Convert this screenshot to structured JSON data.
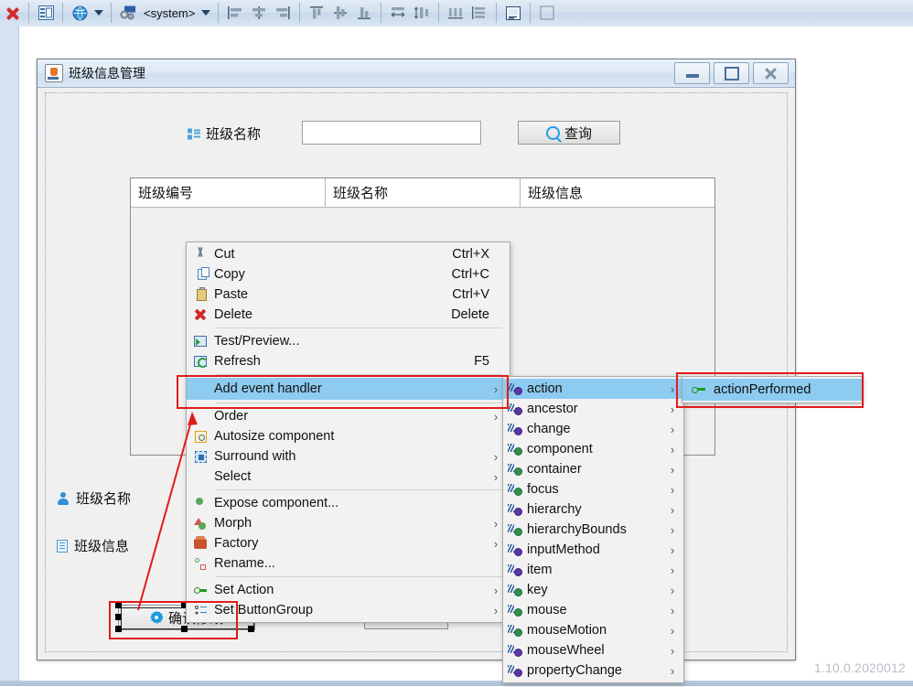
{
  "toolbar": {
    "items": [
      {
        "name": "stop-button",
        "icon": "red-x-icon",
        "label": ""
      },
      {
        "name": "form-editor-button",
        "icon": "form-icon",
        "label": ""
      },
      {
        "name": "preview-design-button",
        "icon": "globe-icon",
        "label": ""
      },
      {
        "name": "look-and-feel-selector",
        "icon": "laf-icon",
        "label": "<system>"
      }
    ],
    "laf_value": "<system>",
    "align_group_1": [
      "align-left-icon",
      "align-center-h-icon",
      "align-right-icon"
    ],
    "align_group_2": [
      "align-top-icon",
      "align-middle-v-icon",
      "align-bottom-icon"
    ],
    "size_group": [
      "same-width-icon",
      "same-height-icon"
    ],
    "space_group": [
      "space-horizontal-icon",
      "space-vertical-icon"
    ],
    "extra_group": [
      "preview-layout-icon",
      "grid-icon"
    ]
  },
  "dialog": {
    "title": "班级信息管理",
    "title_icon": "java-coffee-icon",
    "window_buttons": {
      "minimize": "minimize-icon",
      "maximize": "maximize-icon",
      "close": "close-icon"
    },
    "search": {
      "label": "班级名称",
      "label_icon": "list-icon",
      "input_value": "",
      "input_placeholder": "",
      "button_label": "查询",
      "button_icon": "search-icon"
    },
    "table": {
      "columns": [
        "班级编号",
        "班级名称",
        "班级信息"
      ],
      "rows": []
    },
    "form_fields": [
      {
        "icon": "person-icon",
        "label": "班级名称"
      },
      {
        "icon": "document-icon",
        "label": "班级信息"
      }
    ],
    "selected_button": {
      "label": "确认修改",
      "icon": "gear-icon"
    }
  },
  "context_menu": {
    "groups": [
      [
        {
          "icon": "cut-icon",
          "label": "Cut",
          "accel": "Ctrl+X",
          "submenu": false,
          "selected": false
        },
        {
          "icon": "copy-icon",
          "label": "Copy",
          "accel": "Ctrl+C",
          "submenu": false,
          "selected": false
        },
        {
          "icon": "paste-icon",
          "label": "Paste",
          "accel": "Ctrl+V",
          "submenu": false,
          "selected": false
        },
        {
          "icon": "delete-icon",
          "label": "Delete",
          "accel": "Delete",
          "submenu": false,
          "selected": false
        }
      ],
      [
        {
          "icon": "test-preview-icon",
          "label": "Test/Preview...",
          "accel": "",
          "submenu": false,
          "selected": false
        },
        {
          "icon": "refresh-icon",
          "label": "Refresh",
          "accel": "F5",
          "submenu": false,
          "selected": false
        }
      ],
      [
        {
          "icon": "none",
          "label": "Add event handler",
          "accel": "",
          "submenu": true,
          "selected": true
        }
      ],
      [
        {
          "icon": "none",
          "label": "Order",
          "accel": "",
          "submenu": true,
          "selected": false
        },
        {
          "icon": "autosize-icon",
          "label": "Autosize component",
          "accel": "",
          "submenu": false,
          "selected": false
        },
        {
          "icon": "surround-icon",
          "label": "Surround with",
          "accel": "",
          "submenu": true,
          "selected": false
        },
        {
          "icon": "none",
          "label": "Select",
          "accel": "",
          "submenu": true,
          "selected": false
        }
      ],
      [
        {
          "icon": "expose-icon",
          "label": "Expose component...",
          "accel": "",
          "submenu": false,
          "selected": false
        },
        {
          "icon": "morph-icon",
          "label": "Morph",
          "accel": "",
          "submenu": true,
          "selected": false
        },
        {
          "icon": "factory-icon",
          "label": "Factory",
          "accel": "",
          "submenu": true,
          "selected": false
        },
        {
          "icon": "rename-icon",
          "label": "Rename...",
          "accel": "",
          "submenu": false,
          "selected": false
        }
      ],
      [
        {
          "icon": "set-action-icon",
          "label": "Set Action",
          "accel": "",
          "submenu": true,
          "selected": false
        },
        {
          "icon": "set-buttongroup-icon",
          "label": "Set ButtonGroup",
          "accel": "",
          "submenu": true,
          "selected": false
        }
      ]
    ]
  },
  "events_menu": {
    "items": [
      {
        "label": "action",
        "icon": "event-icon-purple",
        "selected": true
      },
      {
        "label": "ancestor",
        "icon": "event-icon-purple",
        "selected": false
      },
      {
        "label": "change",
        "icon": "event-icon-purple",
        "selected": false
      },
      {
        "label": "component",
        "icon": "event-icon-green",
        "selected": false
      },
      {
        "label": "container",
        "icon": "event-icon-green",
        "selected": false
      },
      {
        "label": "focus",
        "icon": "event-icon-green",
        "selected": false
      },
      {
        "label": "hierarchy",
        "icon": "event-icon-purple",
        "selected": false
      },
      {
        "label": "hierarchyBounds",
        "icon": "event-icon-green",
        "selected": false
      },
      {
        "label": "inputMethod",
        "icon": "event-icon-purple",
        "selected": false
      },
      {
        "label": "item",
        "icon": "event-icon-purple",
        "selected": false
      },
      {
        "label": "key",
        "icon": "event-icon-green",
        "selected": false
      },
      {
        "label": "mouse",
        "icon": "event-icon-green",
        "selected": false
      },
      {
        "label": "mouseMotion",
        "icon": "event-icon-green",
        "selected": false
      },
      {
        "label": "mouseWheel",
        "icon": "event-icon-purple",
        "selected": false
      },
      {
        "label": "propertyChange",
        "icon": "event-icon-purple",
        "selected": false
      }
    ]
  },
  "action_submenu": {
    "items": [
      {
        "label": "actionPerformed",
        "icon": "action-performed-icon",
        "selected": true
      }
    ]
  },
  "status": {
    "version": "1.10.0.2020012"
  }
}
